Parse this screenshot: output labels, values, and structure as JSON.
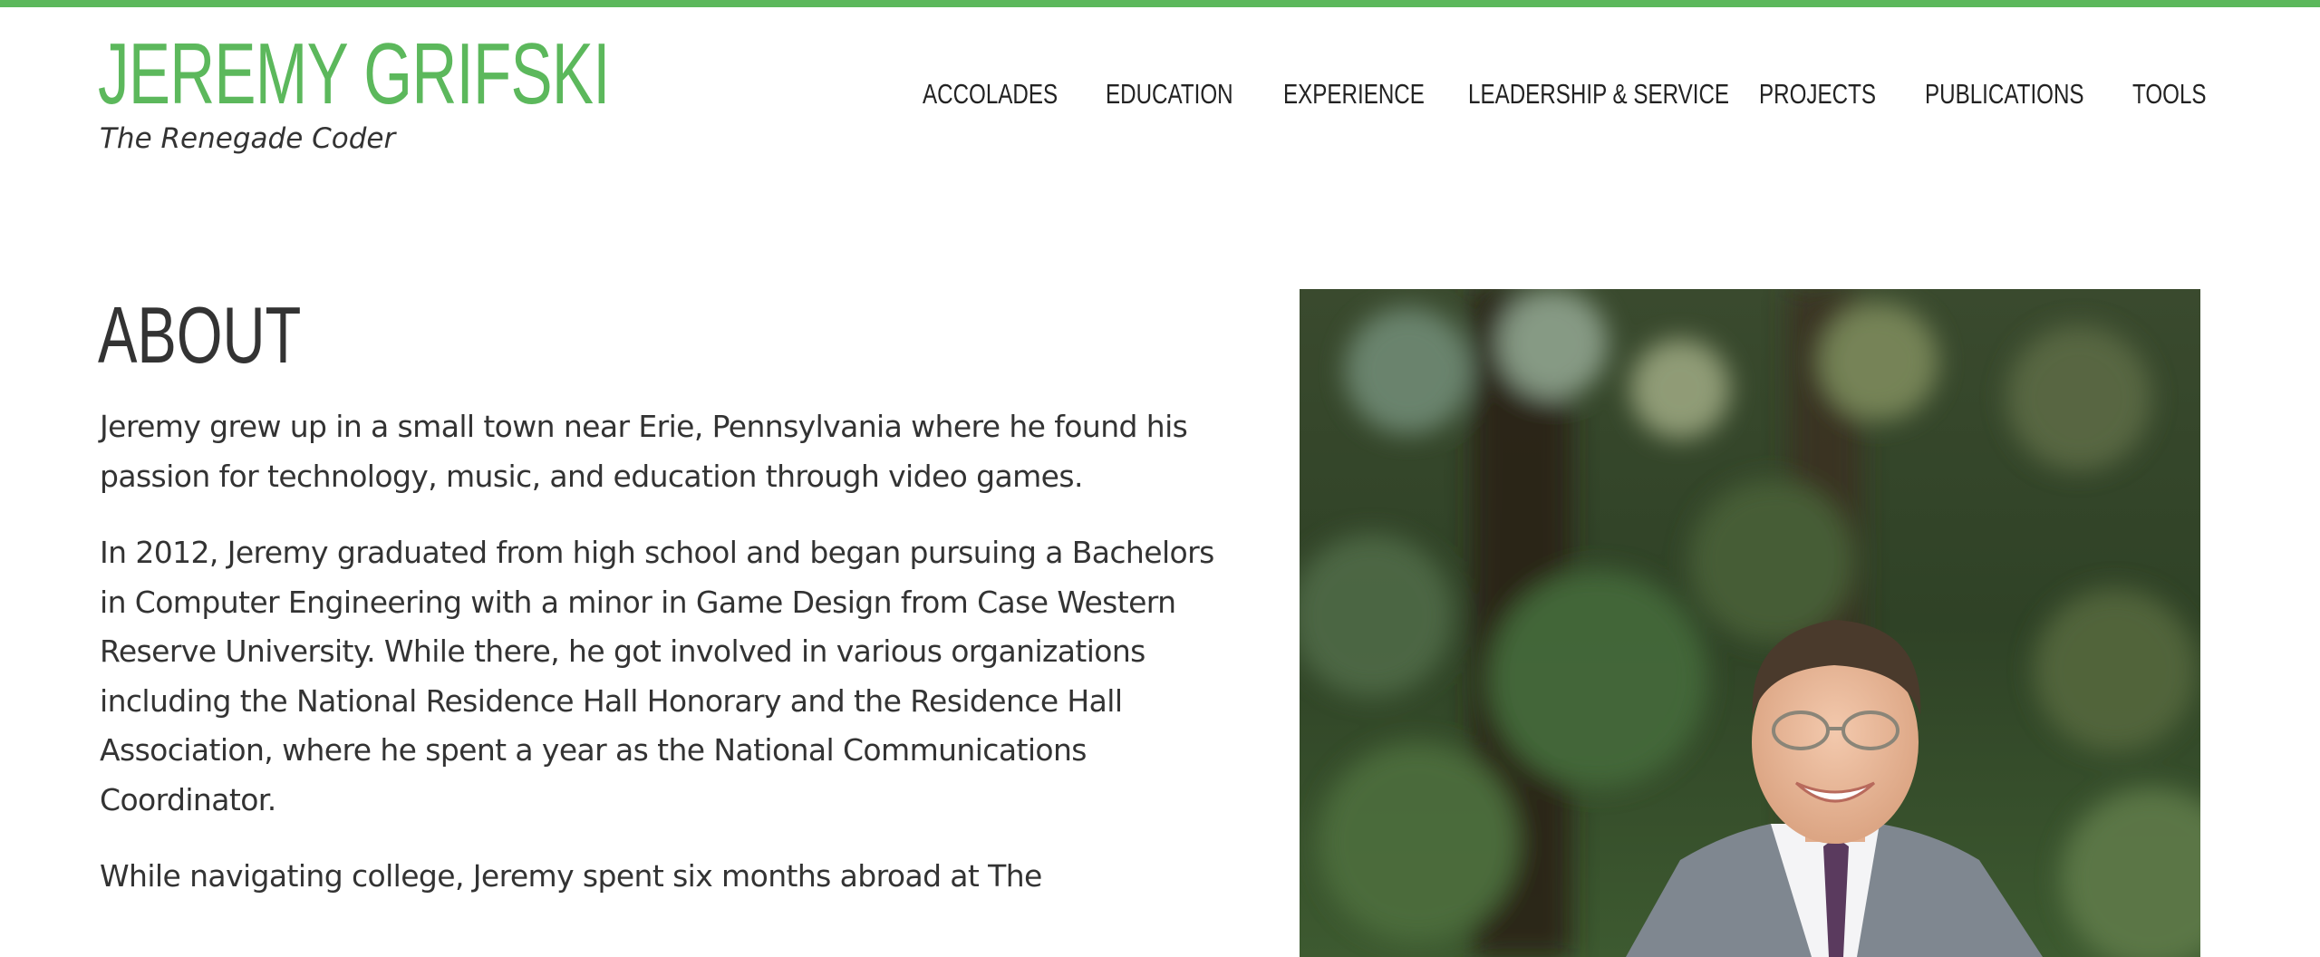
{
  "colors": {
    "accent": "#5cb85c",
    "text": "#333333",
    "nav_text": "#222222",
    "background": "#ffffff"
  },
  "header": {
    "site_title": "JEREMY GRIFSKI",
    "tagline": "The Renegade Coder"
  },
  "nav": {
    "items": [
      {
        "label": "ACCOLADES"
      },
      {
        "label": "EDUCATION"
      },
      {
        "label": "EXPERIENCE"
      },
      {
        "label": "LEADERSHIP & SERVICE"
      },
      {
        "label": "PROJECTS"
      },
      {
        "label": "PUBLICATIONS"
      },
      {
        "label": "TOOLS"
      }
    ]
  },
  "about": {
    "heading": "ABOUT",
    "paragraphs": [
      "Jeremy grew up in a small town near Erie, Pennsylvania where he found his passion for technology, music, and education through video games.",
      "In 2012, Jeremy graduated from high school and began pursuing a Bachelors in Computer Engineering with a minor in Game Design from Case Western Reserve University. While there, he got involved in various organizations including the National Residence Hall Honorary and the Residence Hall Association, where he spent a year as the National Communications Coordinator.",
      "While navigating college, Jeremy spent six months abroad at The"
    ]
  },
  "photo": {
    "icon": "portrait-photo"
  }
}
